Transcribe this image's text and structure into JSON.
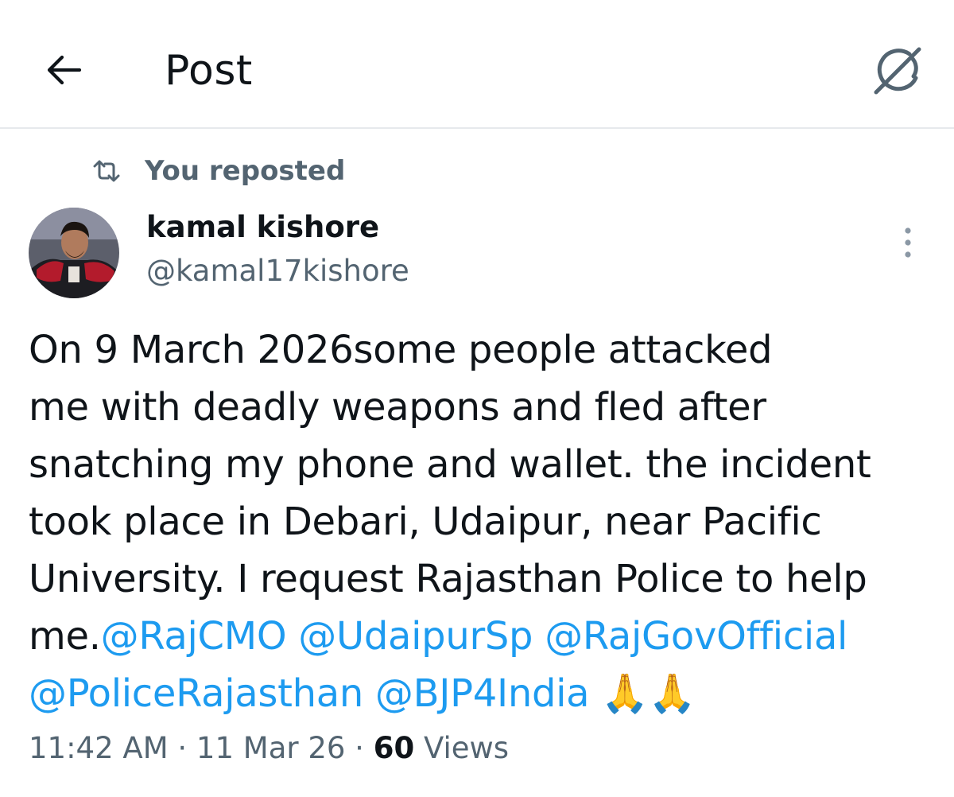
{
  "header": {
    "title": "Post",
    "back_icon": "arrow-left-icon",
    "grok_icon": "grok-icon"
  },
  "repost": {
    "label": "You reposted",
    "icon": "repost-icon"
  },
  "author": {
    "display_name": "kamal kishore",
    "handle": "@kamal17kishore"
  },
  "post": {
    "line1": "On 9 March 2026some people attacked",
    "line2": "me with deadly weapons and fled after",
    "line3": "snatching my phone and wallet. the incident",
    "line4": "took place in Debari, Udaipur, near Pacific",
    "line5": "University. I request Rajasthan Police to help",
    "line6_prefix": "me.",
    "mentions": [
      "@RajCMO",
      "@UdaipurSp",
      "@RajGovOfficial",
      "@PoliceRajasthan",
      "@BJP4India"
    ],
    "emoji": "🙏🙏"
  },
  "meta": {
    "time": "11:42 AM",
    "separator": " · ",
    "date": "11 Mar 26",
    "views_count": "60",
    "views_label": "Views"
  },
  "colors": {
    "text": "#0f1419",
    "secondary": "#536471",
    "link": "#1d9bf0",
    "divider": "#e6e9ec"
  }
}
